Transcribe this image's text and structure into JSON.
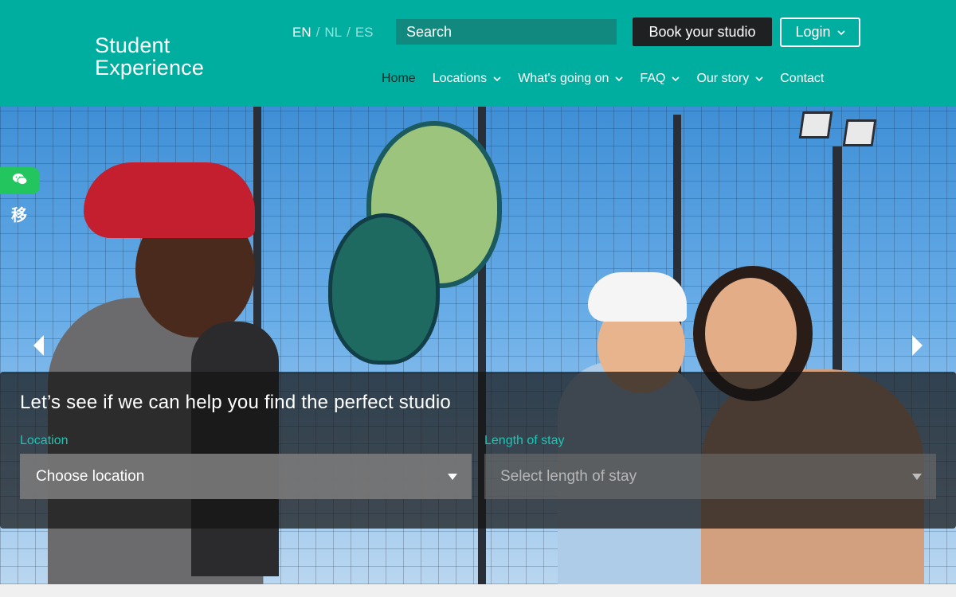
{
  "brand": {
    "line1": "Student",
    "line2": "Experience"
  },
  "languages": [
    {
      "code": "EN",
      "active": true
    },
    {
      "code": "NL",
      "active": false
    },
    {
      "code": "ES",
      "active": false
    }
  ],
  "lang_separator": "/",
  "search": {
    "placeholder": "Search"
  },
  "actions": {
    "book_label": "Book your studio",
    "login_label": "Login"
  },
  "nav": [
    {
      "label": "Home",
      "dropdown": false,
      "active": true
    },
    {
      "label": "Locations",
      "dropdown": true
    },
    {
      "label": "What's going on",
      "dropdown": true
    },
    {
      "label": "FAQ",
      "dropdown": true
    },
    {
      "label": "Our story",
      "dropdown": true
    },
    {
      "label": "Contact",
      "dropdown": false
    }
  ],
  "hero": {
    "finder_title": "Let’s see if we can help you find the perfect studio",
    "location": {
      "label": "Location",
      "value": "Choose location"
    },
    "length": {
      "label": "Length of stay",
      "placeholder": "Select length of stay"
    }
  },
  "widget": {
    "wechat_text": "移"
  },
  "icons": {
    "carousel_prev": "chevron-left-icon",
    "carousel_next": "chevron-right-icon",
    "wechat": "wechat-icon",
    "dropdown": "chevron-down-icon",
    "select_caret": "caret-down-icon"
  },
  "colors": {
    "header_bg": "#00aea0",
    "search_bg": "#12897f",
    "book_bg": "#1f2021",
    "label_accent": "#19c7b5",
    "wechat_green": "#22c55e"
  }
}
